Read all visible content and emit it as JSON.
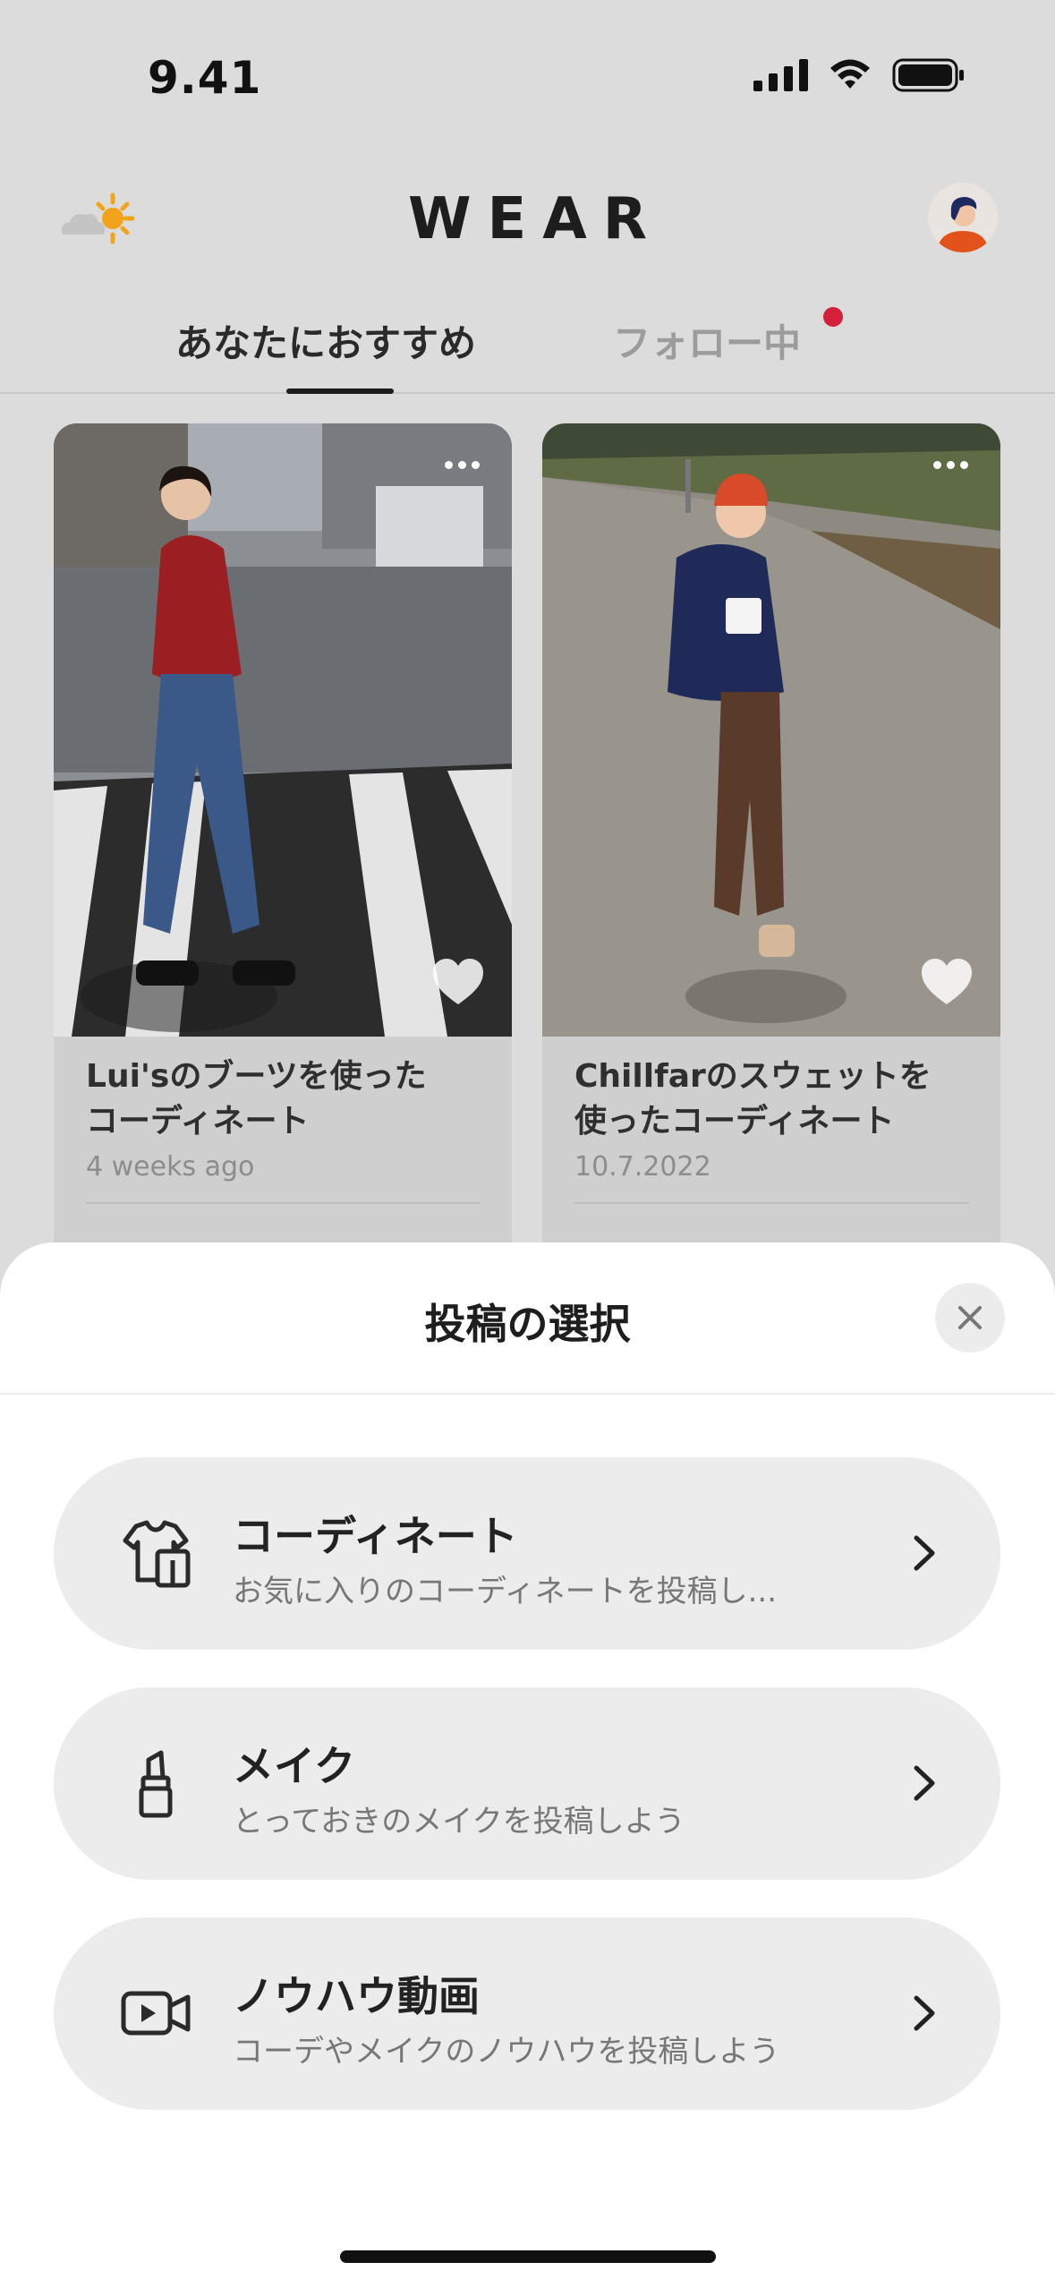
{
  "status_bar": {
    "time": "9.41"
  },
  "header": {
    "title": "WEAR",
    "weather_icon": "cloud-sun-icon",
    "avatar_icon": "avatar"
  },
  "tabs": [
    {
      "label": "あなたにおすすめ",
      "active": true
    },
    {
      "label": "フォロー中",
      "active": false,
      "has_notification": true
    }
  ],
  "cards": [
    {
      "title_line1": "Lui'sのブーツを使った",
      "title_line2": "コーディネート",
      "date": "4 weeks ago"
    },
    {
      "title_line1": "Chillfarのスウェットを",
      "title_line2": "使ったコーディネート",
      "date": "10.7.2022"
    }
  ],
  "sheet": {
    "title": "投稿の選択",
    "options": [
      {
        "title": "コーディネート",
        "subtitle": "お気に入りのコーディネートを投稿し...",
        "icon": "clothes-icon"
      },
      {
        "title": "メイク",
        "subtitle": "とっておきのメイクを投稿しよう",
        "icon": "lipstick-icon"
      },
      {
        "title": "ノウハウ動画",
        "subtitle": "コーデやメイクのノウハウを投稿しよう",
        "icon": "video-camera-icon"
      }
    ]
  },
  "colors": {
    "notification": "#d4203a",
    "background_dim": "#dcdcdc",
    "sheet_bg": "#ffffff",
    "option_bg": "#ececec"
  }
}
